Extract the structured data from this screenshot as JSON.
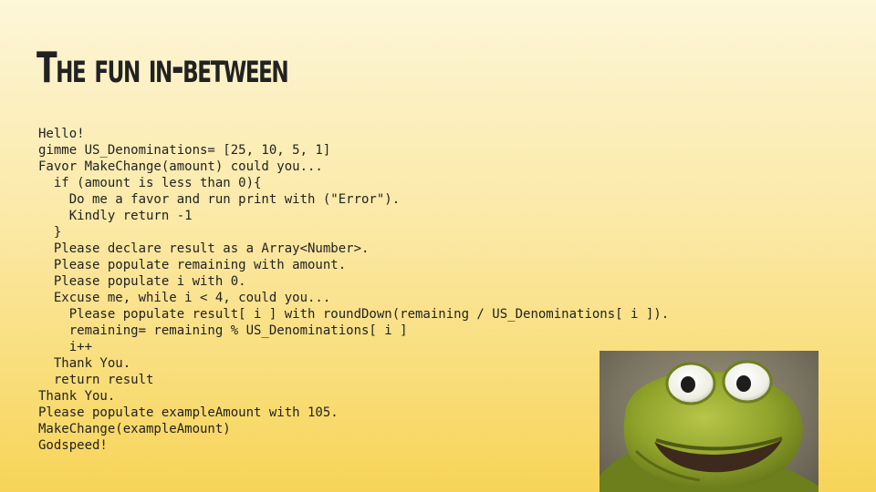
{
  "slide": {
    "title": "The fun in-between",
    "code_lines": [
      "Hello!",
      "gimme US_Denominations= [25, 10, 5, 1]",
      "Favor MakeChange(amount) could you...",
      "  if (amount is less than 0){",
      "    Do me a favor and run print with (\"Error\").",
      "    Kindly return -1",
      "  }",
      "  Please declare result as a Array<Number>.",
      "  Please populate remaining with amount.",
      "  Please populate i with 0.",
      "  Excuse me, while i < 4, could you...",
      "    Please populate result[ i ] with roundDown(remaining / US_Denominations[ i ]).",
      "    remaining= remaining % US_Denominations[ i ]",
      "    i++",
      "  Thank You.",
      "  return result",
      "Thank You.",
      "Please populate exampleAmount with 105.",
      "MakeChange(exampleAmount)",
      "Godspeed!"
    ],
    "image_icon": "kermit-frog-image"
  }
}
